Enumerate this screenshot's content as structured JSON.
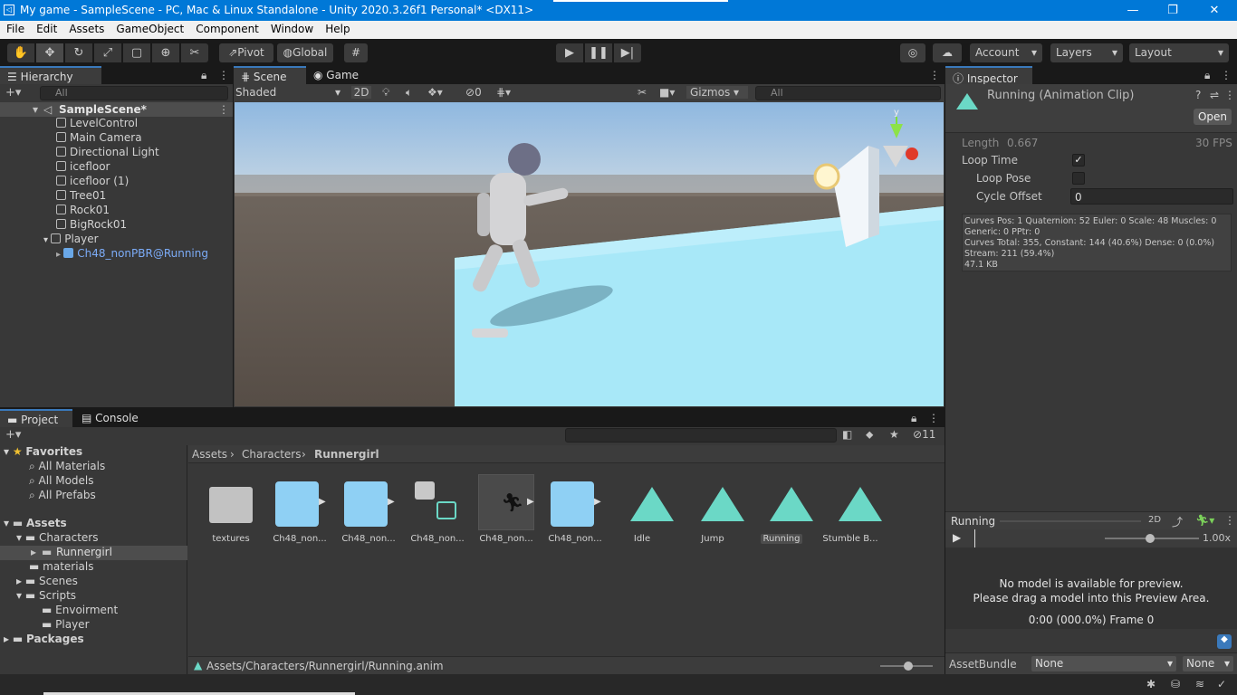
{
  "window": {
    "title": "My game - SampleScene - PC, Mac & Linux Standalone - Unity 2020.3.26f1 Personal* <DX11>",
    "minimize": "—",
    "restore": "❐",
    "close": "✕"
  },
  "menu": [
    "File",
    "Edit",
    "Assets",
    "GameObject",
    "Component",
    "Window",
    "Help"
  ],
  "toolbar": {
    "pivot": "Pivot",
    "global": "Global",
    "account": "Account",
    "layers": "Layers",
    "layout": "Layout"
  },
  "hierarchy": {
    "tab": "Hierarchy",
    "search_placeholder": "All",
    "scene": "SampleScene*",
    "items": [
      "LevelControl",
      "Main Camera",
      "Directional Light",
      "icefloor",
      "icefloor (1)",
      "Tree01",
      "Rock01",
      "BigRock01",
      "Player"
    ],
    "child": "Ch48_nonPBR@Running"
  },
  "scene": {
    "tab_scene": "Scene",
    "tab_game": "Game",
    "shading": "Shaded",
    "mode_2d": "2D",
    "hidden_count": "0",
    "gizmos": "Gizmos",
    "search_placeholder": "All",
    "axis_y": "y"
  },
  "inspector": {
    "tab": "Inspector",
    "asset_title": "Running (Animation Clip)",
    "open": "Open",
    "length_label": "Length",
    "length_value": "0.667",
    "fps": "30 FPS",
    "loop_time": "Loop Time",
    "loop_pose": "Loop Pose",
    "cycle_offset": "Cycle Offset",
    "cycle_offset_value": "0",
    "loop_time_checked": true,
    "loop_pose_checked": false,
    "info": [
      "Curves Pos: 1 Quaternion: 52 Euler: 0 Scale: 48 Muscles: 0",
      "Generic: 0 PPtr: 0",
      "Curves Total: 355, Constant: 144 (40.6%) Dense: 0 (0.0%)",
      "Stream: 211 (59.4%)",
      "47.1 KB"
    ],
    "preview_title": "Running",
    "preview_2d": "2D",
    "speed": "1.00x",
    "no_model_1": "No model is available for preview.",
    "no_model_2": "Please drag a model into this Preview Area.",
    "frame": "0:00 (000.0%) Frame 0",
    "assetbundle_label": "AssetBundle",
    "assetbundle_value": "None",
    "variant_value": "None"
  },
  "project": {
    "tab_project": "Project",
    "tab_console": "Console",
    "hidden_count": "11",
    "favorites": "Favorites",
    "favorite_items": [
      "All Materials",
      "All Models",
      "All Prefabs"
    ],
    "assets_root": "Assets",
    "tree": {
      "characters": "Characters",
      "runnergirl": "Runnergirl",
      "materials": "materials",
      "scenes": "Scenes",
      "scripts": "Scripts",
      "envoirment": "Envoirment",
      "player": "Player",
      "packages": "Packages"
    },
    "breadcrumb": [
      "Assets",
      "Characters",
      "Runnergirl"
    ],
    "assets": [
      "textures",
      "Ch48_non...",
      "Ch48_non...",
      "Ch48_non...",
      "Ch48_non...",
      "Ch48_non...",
      "Idle",
      "Jump",
      "Running",
      "Stumble B..."
    ],
    "path": "Assets/Characters/Runnergirl/Running.anim"
  },
  "colors": {
    "accent": "#3a79bb",
    "anim_clip": "#6bd8c6",
    "sky": "#a9cbe8",
    "ice": "#a8e8f8"
  }
}
